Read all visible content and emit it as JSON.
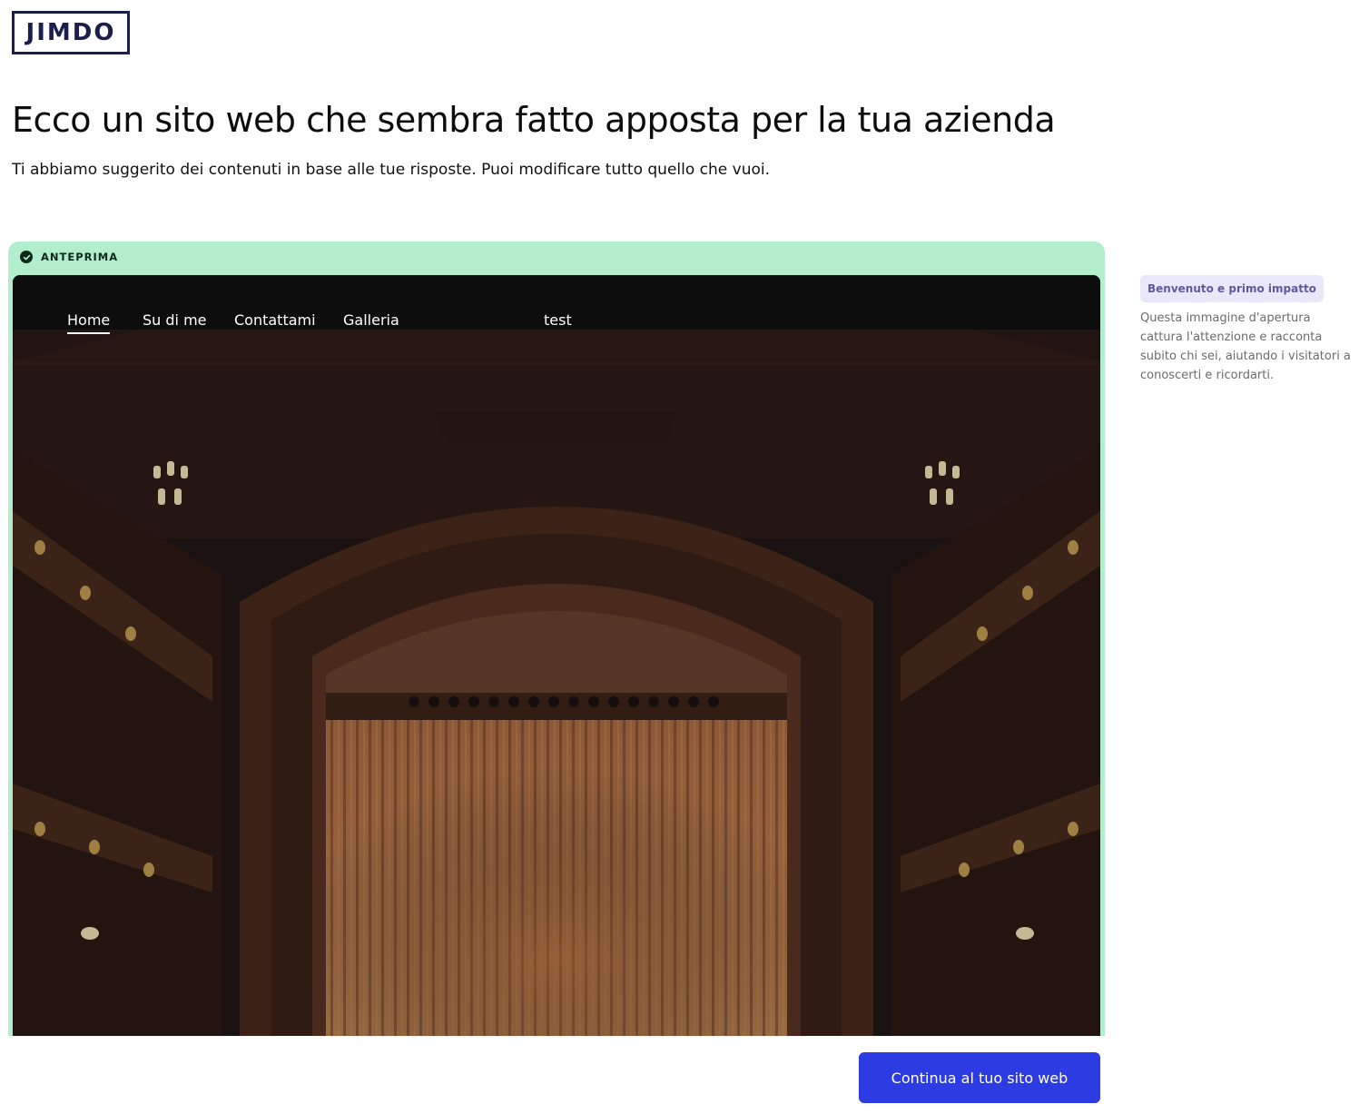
{
  "brand": {
    "logo_text": "JIMDO",
    "primary_color": "#2d3be2",
    "preview_accent": "#b2eecb"
  },
  "header": {
    "title": "Ecco un sito web che sembra fatto apposta per la tua azienda",
    "subtitle": "Ti abbiamo suggerito dei contenuti in base alle tue risposte. Puoi modificare tutto quello che vuoi."
  },
  "preview": {
    "label": "ANTEPRIMA",
    "status_icon": "check-circle-icon",
    "site": {
      "nav": [
        {
          "label": "Home",
          "active": true
        },
        {
          "label": "Su di me",
          "active": false
        },
        {
          "label": "Contattami",
          "active": false
        },
        {
          "label": "Galleria",
          "active": false
        }
      ],
      "site_title": "test",
      "hero_image": "theatre-stage-curtain"
    }
  },
  "sidebar_note": {
    "tag": "Benvenuto e primo impatto",
    "text": "Questa immagine d'apertura cattura l'attenzione e racconta subito chi sei, aiutando i visitatori a conoscerti e ricordarti."
  },
  "cta": {
    "label": "Continua al tuo sito web"
  }
}
